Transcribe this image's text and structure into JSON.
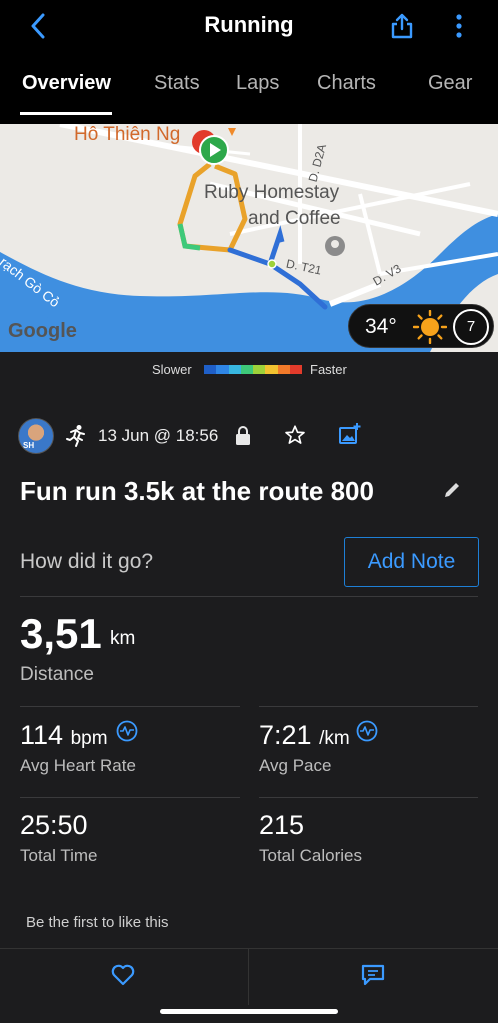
{
  "header": {
    "title": "Running",
    "back_icon": "back-chevron-icon",
    "share_icon": "share-icon",
    "more_icon": "more-vertical-icon"
  },
  "tabs": [
    {
      "label": "Overview",
      "active": true
    },
    {
      "label": "Stats",
      "active": false
    },
    {
      "label": "Laps",
      "active": false
    },
    {
      "label": "Charts",
      "active": false
    },
    {
      "label": "Gear",
      "active": false
    }
  ],
  "map": {
    "labels": {
      "place1": "Hô Thiên Ng",
      "place2": "Ruby Homestay",
      "place3": "and Coffee",
      "road1": "D. D2A",
      "road2": "D. T21",
      "road3": "D. V3",
      "river": "rạch Gò Cỏ",
      "google": "Google"
    },
    "weather": {
      "temp": "34°",
      "wind": "7",
      "icon": "sunny-icon"
    }
  },
  "legend": {
    "slower": "Slower",
    "faster": "Faster",
    "colors": [
      "#1f5fc8",
      "#2f86e6",
      "#38b7e0",
      "#3ec97a",
      "#9ed23a",
      "#f2c230",
      "#f27a2a",
      "#e23b2b"
    ]
  },
  "activity": {
    "date": "13 Jun @ 18:56",
    "avatar_tag": "SH",
    "title": "Fun run 3.5k at the route 800",
    "note_prompt": "How did it go?",
    "add_note": "Add Note"
  },
  "stats": {
    "distance": {
      "value": "3,51",
      "unit": "km",
      "label": "Distance"
    },
    "heart_rate": {
      "value": "114",
      "unit": "bpm",
      "label": "Avg Heart Rate"
    },
    "pace": {
      "value": "7:21",
      "unit": "/km",
      "label": "Avg Pace"
    },
    "time": {
      "value": "25:50",
      "label": "Total Time"
    },
    "calories": {
      "value": "215",
      "label": "Total Calories"
    }
  },
  "social": {
    "likes_text": "Be the first to like this"
  },
  "colors": {
    "accent": "#3b9aff",
    "background": "#1c1c1e"
  }
}
